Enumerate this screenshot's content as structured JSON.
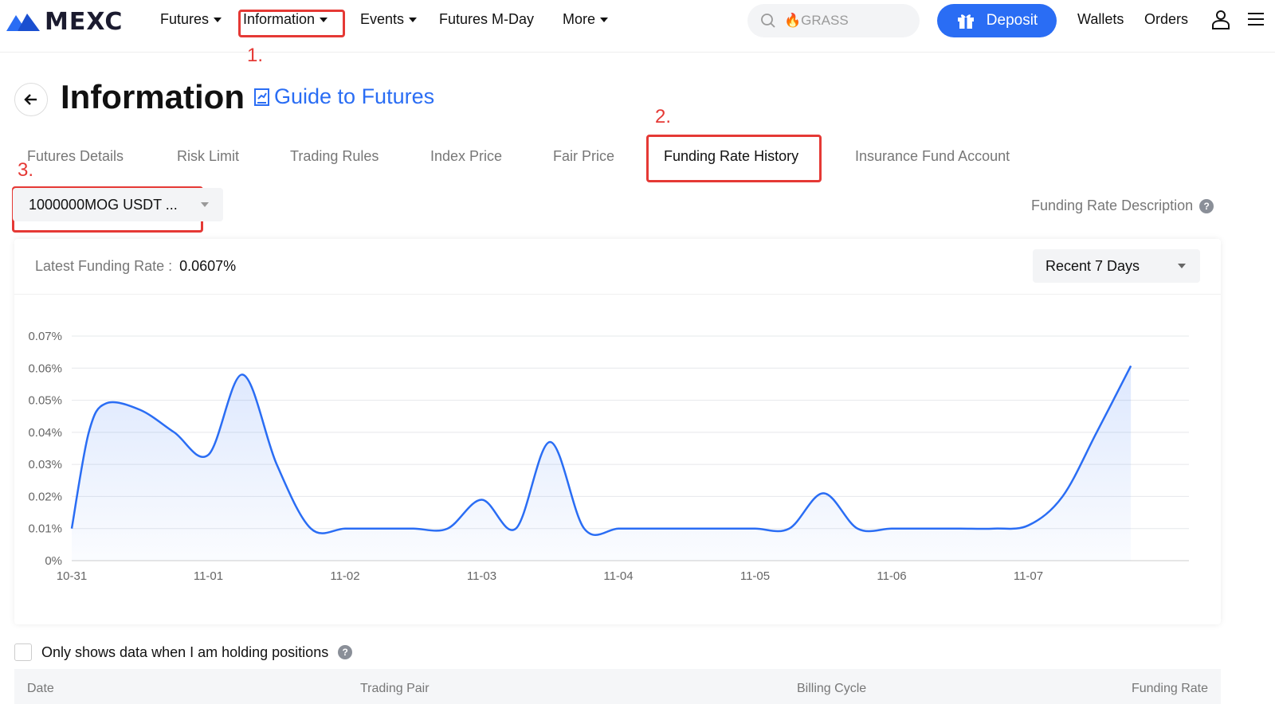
{
  "brand": {
    "name": "MEXC",
    "accent": "#2a6df4",
    "annotation_color": "#e53935"
  },
  "nav": {
    "futures": "Futures",
    "information": "Information",
    "events": "Events",
    "futures_mday": "Futures M-Day",
    "more": "More"
  },
  "search": {
    "placeholder": "🔥GRASS"
  },
  "deposit_label": "Deposit",
  "wallets_label": "Wallets",
  "orders_label": "Orders",
  "annotations": [
    "1.",
    "2.",
    "3."
  ],
  "page": {
    "title": "Information",
    "guide_link": "Guide to Futures"
  },
  "tabs": [
    {
      "label": "Futures Details"
    },
    {
      "label": "Risk Limit"
    },
    {
      "label": "Trading Rules"
    },
    {
      "label": "Index Price"
    },
    {
      "label": "Fair Price"
    },
    {
      "label": "Funding Rate History",
      "active": true
    },
    {
      "label": "Insurance Fund Account"
    }
  ],
  "pair_select": {
    "value": "1000000MOG USDT ..."
  },
  "funding_desc": "Funding Rate Description",
  "card": {
    "latest_label": "Latest Funding Rate :",
    "latest_value": "0.0607%",
    "range_value": "Recent 7 Days"
  },
  "chart_data": {
    "type": "area",
    "x_ticks": [
      "10-31",
      "11-01",
      "11-02",
      "11-03",
      "11-04",
      "11-05",
      "11-06",
      "11-07"
    ],
    "y_ticks": [
      "0%",
      "0.01%",
      "0.02%",
      "0.03%",
      "0.04%",
      "0.05%",
      "0.06%",
      "0.07%"
    ],
    "ylim": [
      0,
      0.07
    ],
    "x_days": [
      0,
      0.125,
      0.25,
      0.5,
      0.75,
      1.0,
      1.25,
      1.5,
      1.75,
      2.0,
      2.25,
      2.5,
      2.75,
      3.0,
      3.25,
      3.5,
      3.75,
      4.0,
      4.25,
      4.5,
      4.75,
      5.0,
      5.25,
      5.5,
      5.75,
      6.0,
      6.25,
      6.5,
      6.75,
      7.0,
      7.25,
      7.5,
      7.75
    ],
    "values": [
      0.01,
      0.04,
      0.049,
      0.047,
      0.04,
      0.033,
      0.058,
      0.03,
      0.01,
      0.01,
      0.01,
      0.01,
      0.01,
      0.019,
      0.01,
      0.037,
      0.01,
      0.01,
      0.01,
      0.01,
      0.01,
      0.01,
      0.01,
      0.021,
      0.01,
      0.01,
      0.01,
      0.01,
      0.01,
      0.011,
      0.02,
      0.04,
      0.0607
    ],
    "line_color": "#2a6df4",
    "grid": true
  },
  "holding_label": "Only shows data when I am holding positions",
  "table": {
    "headers": [
      "Date",
      "Trading Pair",
      "Billing Cycle",
      "Funding Rate"
    ]
  }
}
